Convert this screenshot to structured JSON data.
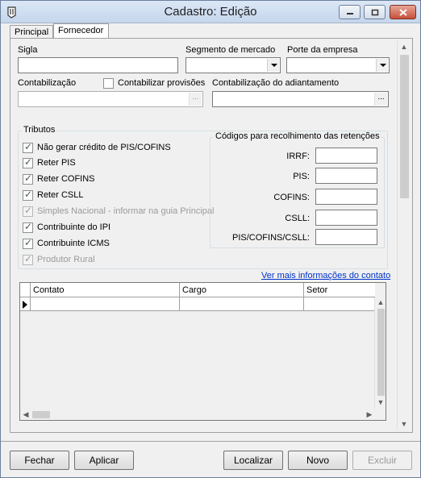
{
  "window": {
    "title": "Cadastro: Edição",
    "icon": "app-icon"
  },
  "tabs": [
    {
      "label": "Principal"
    },
    {
      "label": "Fornecedor",
      "selected": true
    }
  ],
  "fields": {
    "sigla_label": "Sigla",
    "sigla_value": "",
    "segmento_label": "Segmento de mercado",
    "segmento_value": "",
    "porte_label": "Porte da empresa",
    "porte_value": "",
    "contabilizacao_label": "Contabilização",
    "contabilizacao_value": "",
    "contabilizar_provisoes_label": "Contabilizar provisões",
    "contabilizar_provisoes_checked": false,
    "adiantamento_label": "Contabilização do adiantamento",
    "adiantamento_value": "",
    "ellipsis": "..."
  },
  "tributos": {
    "title": "Tributos",
    "items": [
      {
        "label": "Não gerar crédito de PIS/COFINS",
        "checked": true,
        "enabled": true
      },
      {
        "label": "Reter PIS",
        "checked": true,
        "enabled": true
      },
      {
        "label": "Reter COFINS",
        "checked": true,
        "enabled": true
      },
      {
        "label": "Reter CSLL",
        "checked": true,
        "enabled": true
      },
      {
        "label": "Simples Nacional - informar na guia Principal",
        "checked": true,
        "enabled": false
      },
      {
        "label": "Contribuinte do IPI",
        "checked": true,
        "enabled": true
      },
      {
        "label": "Contribuinte ICMS",
        "checked": true,
        "enabled": true
      },
      {
        "label": "Produtor Rural",
        "checked": true,
        "enabled": false
      }
    ]
  },
  "retencoes": {
    "title": "Códigos para recolhimento das retenções",
    "fields": [
      {
        "label": "IRRF:",
        "value": ""
      },
      {
        "label": "PIS:",
        "value": ""
      },
      {
        "label": "COFINS:",
        "value": ""
      },
      {
        "label": "CSLL:",
        "value": ""
      },
      {
        "label": "PIS/COFINS/CSLL:",
        "value": ""
      }
    ]
  },
  "contacts": {
    "link": "Ver mais informações do contato",
    "columns": [
      "Contato",
      "Cargo",
      "Setor"
    ]
  },
  "buttons": {
    "fechar": "Fechar",
    "aplicar": "Aplicar",
    "localizar": "Localizar",
    "novo": "Novo",
    "excluir": "Excluir"
  },
  "colors": {
    "link": "#0033cc",
    "titlebar": "#c5d6ec",
    "close": "#c8503a"
  }
}
